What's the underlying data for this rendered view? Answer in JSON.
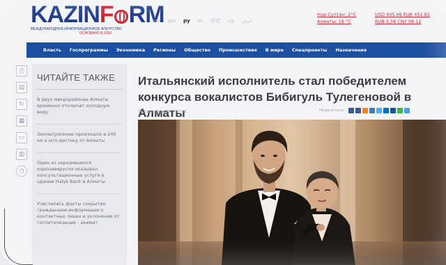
{
  "header": {
    "logo_left": "KAZIN",
    "logo_mid": "F",
    "logo_right": "RM",
    "logo_subtitle": "МЕЖДУНАРОДНОЕ ИНФОРМАЦИОННОЕ АГЕНТСТВО",
    "logo_founded": "ОСНОВАНО В 1920",
    "languages": [
      "қаз",
      "qaz",
      "ру",
      "en",
      "中文",
      "عربي",
      "ﻉﻙ"
    ],
    "active_language": "ру",
    "weather": [
      "Нур-Султан: 2°С",
      "Алматы: 16 °С"
    ],
    "rates": [
      "USD 405.46 EUR 452.82",
      "RUB 5.58 CNY 58.11"
    ],
    "brand_color": "#1d3a8a",
    "accent_color": "#d2202f"
  },
  "nav": {
    "items": [
      "Власть",
      "Госпрограммы",
      "Экономика",
      "Регионы",
      "Общество",
      "Происшествия",
      "В мире",
      "Спецпроекты",
      "Назначения"
    ],
    "bg_color": "#1d4fa0"
  },
  "iconbar": {
    "icons": [
      "print-icon",
      "document-icon",
      "refresh-icon",
      "calendar-icon",
      "archive-icon",
      "books-icon",
      "clock-icon"
    ]
  },
  "sidebar": {
    "title": "ЧИТАЙТЕ ТАКЖЕ",
    "items": [
      "В двух микрорайонах Алматы временно отключат холодную воду",
      "Землетрясение произошло в 245 км к юго-востоку от Алматы",
      "Один из заразившихся коронавирусом оказывал консультационные услуги в здании Halyk Bank в Алматы",
      "Участились факты сокрытия гражданами информации о контактных лицах и уклонение от госпитализации - акимат"
    ]
  },
  "article": {
    "headline": "Итальянский исполнитель стал победителем конкурса вокалистов Бибигуль Тулегеновой в Алматы",
    "date": "24 Сентября 2015 17:42",
    "share_label": "Поделиться:",
    "share_colors": [
      "#3b5998",
      "#d2202f",
      "#f58220",
      "#1d4fa0",
      "#55acee",
      "#0077b5",
      "#5b7fa6",
      "#3cb54a",
      "#47a3da"
    ]
  }
}
